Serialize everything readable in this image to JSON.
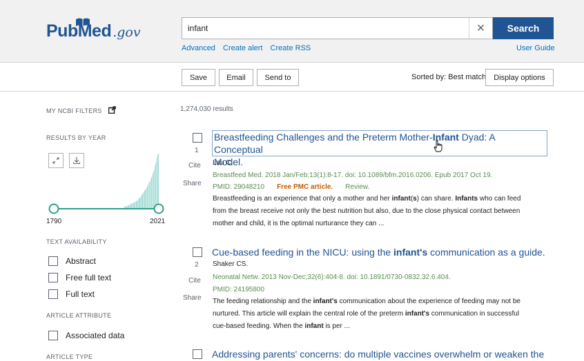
{
  "header": {
    "logo_pub": "Pub",
    "logo_med": "Med",
    "logo_gov": ".gov",
    "search_value": "infant",
    "clear_label": "×",
    "search_label": "Search",
    "links": [
      "Advanced",
      "Create alert",
      "Create RSS"
    ],
    "user_guide": "User Guide"
  },
  "toolbar": {
    "save": "Save",
    "email": "Email",
    "send_to": "Send to",
    "sorted_by": "Sorted by: Best match",
    "display_options": "Display options"
  },
  "sidebar": {
    "my_ncbi_filters": "MY NCBI FILTERS",
    "results_by_year": "RESULTS BY YEAR",
    "year_start": "1790",
    "year_end": "2021",
    "text_availability": "TEXT AVAILABILITY",
    "text_options": [
      "Abstract",
      "Free full text",
      "Full text"
    ],
    "article_attribute": "ARTICLE ATTRIBUTE",
    "attribute_options": [
      "Associated data"
    ],
    "article_type": "ARTICLE TYPE"
  },
  "results": {
    "count": "1,274,030 results",
    "cite_label": "Cite",
    "share_label": "Share",
    "items": [
      {
        "num": "1",
        "title_pre": "Breastfeeding Challenges and the Preterm Mother-",
        "title_bold": "Infant",
        "title_post": " Dyad: A Conceptual",
        "title_line2": "Model.",
        "authors": "Lau C.",
        "journal": "Breastfeed Med. 2018 Jan/Feb;13(1):8-17. doi: 10.1089/bfm.2016.0206. Epub 2017 Oct 19.",
        "pmid": "PMID: 29048210",
        "pmc": "Free PMC article.",
        "type": "Review.",
        "snippet_l1_a": "Breastfeeding is an experience that only a mother and her ",
        "snippet_l1_b": "infant",
        "snippet_l1_c": "(",
        "snippet_l1_d": "s",
        "snippet_l1_e": ") can share. ",
        "snippet_l1_f": "Infants",
        "snippet_l1_g": " who can feed",
        "snippet_l2": "from the breast receive not only the best nutrition but also, due to the close physical contact between",
        "snippet_l3": "mother and child, it is the optimal nurturance they can ..."
      },
      {
        "num": "2",
        "title_pre": "Cue-based feeding in the NICU: using the ",
        "title_bold": "infant's",
        "title_post": " communication as a guide.",
        "authors": "Shaker CS.",
        "journal": "Neonatal Netw. 2013 Nov-Dec;32(6):404-8. doi: 10.1891/0730-0832.32.6.404.",
        "pmid": "PMID: 24195800",
        "snippet_l1_a": "The feeding relationship and the ",
        "snippet_l1_b": "infant's",
        "snippet_l1_c": " communication about the experience of feeding may not be",
        "snippet_l2_a": "nurtured. This article will explain the central role of the preterm ",
        "snippet_l2_b": "infant's",
        "snippet_l2_c": " communication in successful",
        "snippet_l3_a": "cue-based feeding. When the ",
        "snippet_l3_b": "infant",
        "snippet_l3_c": " is per ..."
      },
      {
        "title": "Addressing parents' concerns: do multiple vaccines overwhelm or weaken the"
      }
    ]
  },
  "colors": {
    "brand": "#205493",
    "link": "#0071bc",
    "meta_green": "#5b8a52",
    "pmc_orange": "#c65a00",
    "histogram": "#a9dfd8",
    "slider": "#2e9e8e"
  },
  "icons": {
    "external": "external-link-icon",
    "expand": "expand-icon",
    "download": "download-icon",
    "close": "close-icon",
    "cursor": "hand-pointer-icon"
  }
}
